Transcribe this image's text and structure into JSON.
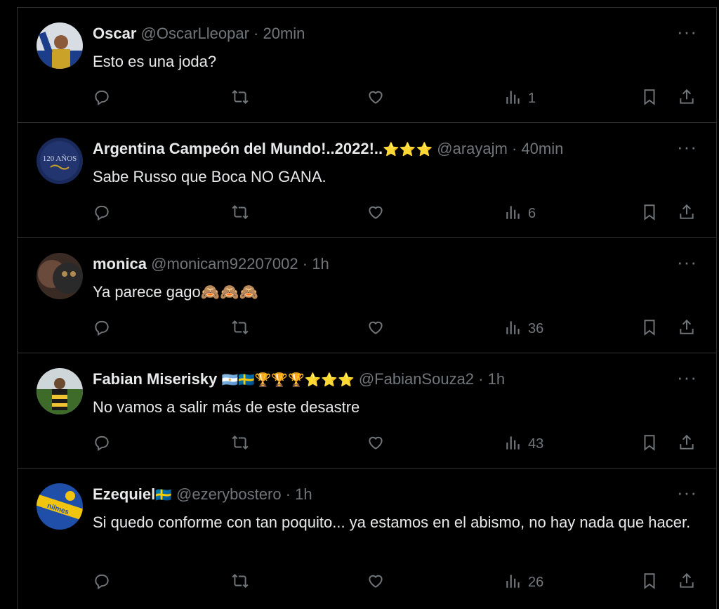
{
  "tweets": [
    {
      "name": "Oscar",
      "name_emoji": "",
      "handle": "@OscarLleopar",
      "time": "20min",
      "text": "Esto es una joda?",
      "views": "1",
      "avatar_colors": [
        "#c9a227",
        "#1b3d8a"
      ]
    },
    {
      "name": "Argentina Campeón del Mundo!..2022!..",
      "name_emoji": "⭐⭐⭐",
      "handle": "@arayajm",
      "time": "40min",
      "text": "Sabe Russo que Boca NO GANA.",
      "views": "6",
      "avatar_colors": [
        "#1a2a5c",
        "#30447e"
      ],
      "avatar_text": "120 AÑOS"
    },
    {
      "name": "monica",
      "name_emoji": "",
      "handle": "@monicam92207002",
      "time": "1h",
      "text": "Ya parece gago🙈🙈🙈",
      "views": "36",
      "avatar_colors": [
        "#6a4a3a",
        "#2a2a2a"
      ]
    },
    {
      "name": "Fabian Miserisky",
      "name_emoji": "🇦🇷🇸🇪🏆🏆🏆⭐⭐⭐",
      "handle": "@FabianSouza2",
      "time": "1h",
      "text": "No vamos a salir más de este desastre",
      "views": "43",
      "avatar_colors": [
        "#3f6b2a",
        "#f1c232"
      ]
    },
    {
      "name": "Ezequiel",
      "name_emoji": "🇸🇪",
      "handle": "@ezerybostero",
      "time": "1h",
      "text": "Si quedo conforme con tan poquito... ya estamos en el abismo, no hay nada que hacer.",
      "views": "26",
      "avatar_colors": [
        "#1f4fa8",
        "#f1c40f"
      ]
    }
  ],
  "ui": {
    "separator": "·",
    "more": "···"
  }
}
